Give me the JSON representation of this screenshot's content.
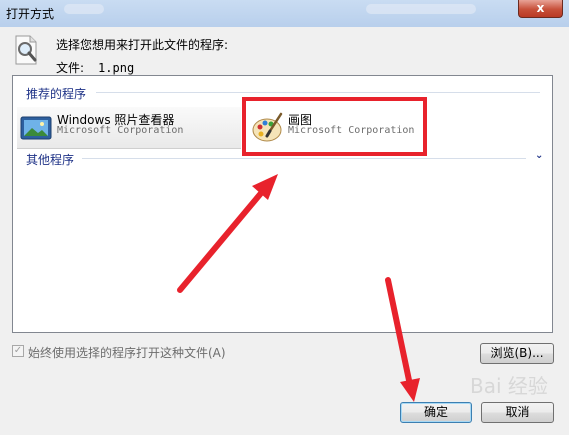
{
  "window": {
    "title": "打开方式",
    "close_glyph": "x"
  },
  "header": {
    "prompt": "选择您想用来打开此文件的程序:",
    "file_label": "文件:",
    "file_name": "1.png"
  },
  "recommended": {
    "group_label": "推荐的程序",
    "programs": [
      {
        "name": "Windows 照片查看器",
        "company": "Microsoft Corporation",
        "icon": "photo-viewer-icon"
      },
      {
        "name": "画图",
        "company": "Microsoft Corporation",
        "icon": "paint-icon"
      }
    ]
  },
  "other": {
    "group_label": "其他程序",
    "expand_glyph": "⌄"
  },
  "options": {
    "always_use_label": "始终使用选择的程序打开这种文件(A)",
    "always_use_checked": true
  },
  "buttons": {
    "browse": "浏览(B)...",
    "ok": "确定",
    "cancel": "取消"
  },
  "watermark": "Bai 经验",
  "colors": {
    "annotation_red": "#e8222c",
    "group_header": "#1e3287"
  }
}
